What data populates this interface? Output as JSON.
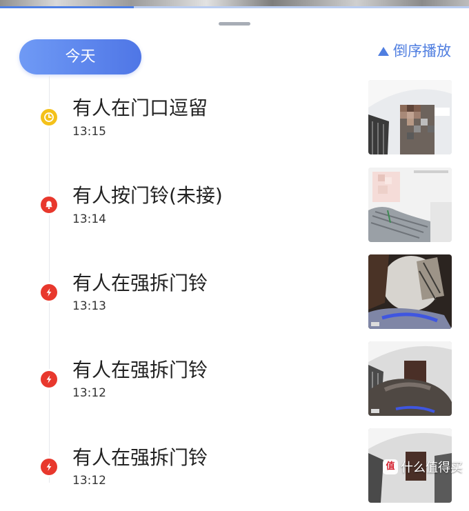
{
  "header": {
    "date_label": "今天",
    "reverse_label": "倒序播放",
    "playback_progress": 0.285
  },
  "events": [
    {
      "title": "有人在门口逗留",
      "time": "13:15",
      "icon": "clock-icon",
      "color": "#f4c11a"
    },
    {
      "title": "有人按门铃(未接)",
      "time": "13:14",
      "icon": "bell-icon",
      "color": "#e8382d"
    },
    {
      "title": "有人在强拆门铃",
      "time": "13:13",
      "icon": "lightning-icon",
      "color": "#e8382d"
    },
    {
      "title": "有人在强拆门铃",
      "time": "13:12",
      "icon": "lightning-icon",
      "color": "#e8382d"
    },
    {
      "title": "有人在强拆门铃",
      "time": "13:12",
      "icon": "lightning-icon",
      "color": "#e8382d"
    }
  ],
  "watermark": {
    "text": "什么值得买",
    "badge": "值"
  },
  "colors": {
    "accent": "#4f7ee0",
    "pill_start": "#6f9af5",
    "pill_end": "#4f76e6"
  }
}
